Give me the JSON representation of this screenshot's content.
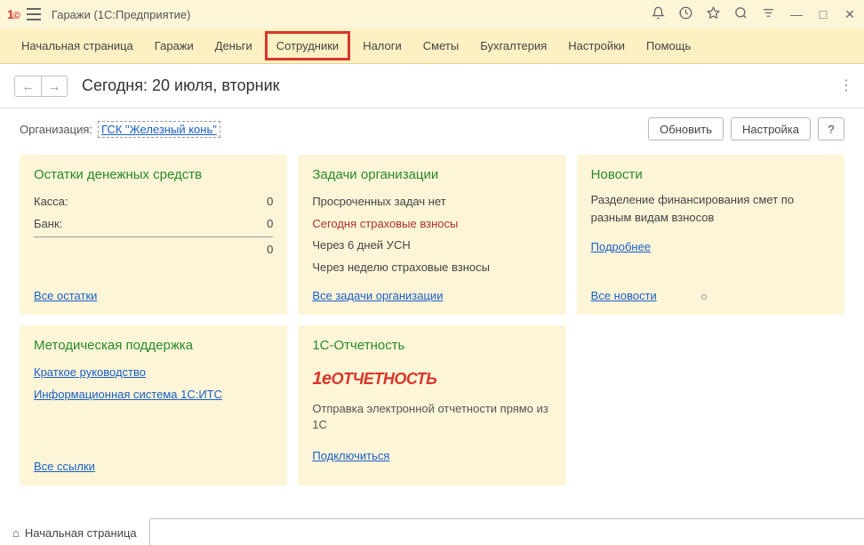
{
  "window": {
    "app_logo_text": "1@",
    "title": "Гаражи  (1С:Предприятие)"
  },
  "menu": {
    "items": [
      {
        "label": "Начальная страница"
      },
      {
        "label": "Гаражи"
      },
      {
        "label": "Деньги"
      },
      {
        "label": "Сотрудники",
        "highlighted": true
      },
      {
        "label": "Налоги"
      },
      {
        "label": "Сметы"
      },
      {
        "label": "Бухгалтерия"
      },
      {
        "label": "Настройки"
      },
      {
        "label": "Помощь"
      }
    ]
  },
  "page": {
    "title": "Сегодня: 20 июля, вторник"
  },
  "org": {
    "label": "Организация:",
    "value": "ГСК \"Железный конь\""
  },
  "actions": {
    "refresh": "Обновить",
    "settings": "Настройка",
    "help": "?"
  },
  "cards": {
    "balances": {
      "title": "Остатки денежных средств",
      "cash_label": "Касса:",
      "cash_value": "0",
      "bank_label": "Банк:",
      "bank_value": "0",
      "total": "0",
      "link": "Все остатки"
    },
    "tasks": {
      "title": "Задачи организации",
      "overdue_none": "Просроченных задач нет",
      "today": "Сегодня страховые взносы",
      "in6days": "Через 6 дней УСН",
      "inweek": "Через неделю страховые взносы",
      "link": "Все задачи организации"
    },
    "news": {
      "title": "Новости",
      "text": "Разделение финансирования смет по разным видам взносов",
      "more": "Подробнее",
      "link": "Все новости"
    },
    "support": {
      "title": "Методическая поддержка",
      "guide": "Краткое руководство",
      "its": "Информационная система 1С:ИТС",
      "link": "Все ссылки"
    },
    "reporting": {
      "title": "1С-Отчетность",
      "logo_prefix": "1@",
      "logo_rest": "ОТЧЕТНОСТЬ",
      "desc": "Отправка электронной отчетности прямо из 1С",
      "connect": "Подключиться"
    }
  },
  "bottom_tab": {
    "label": "Начальная страница"
  }
}
